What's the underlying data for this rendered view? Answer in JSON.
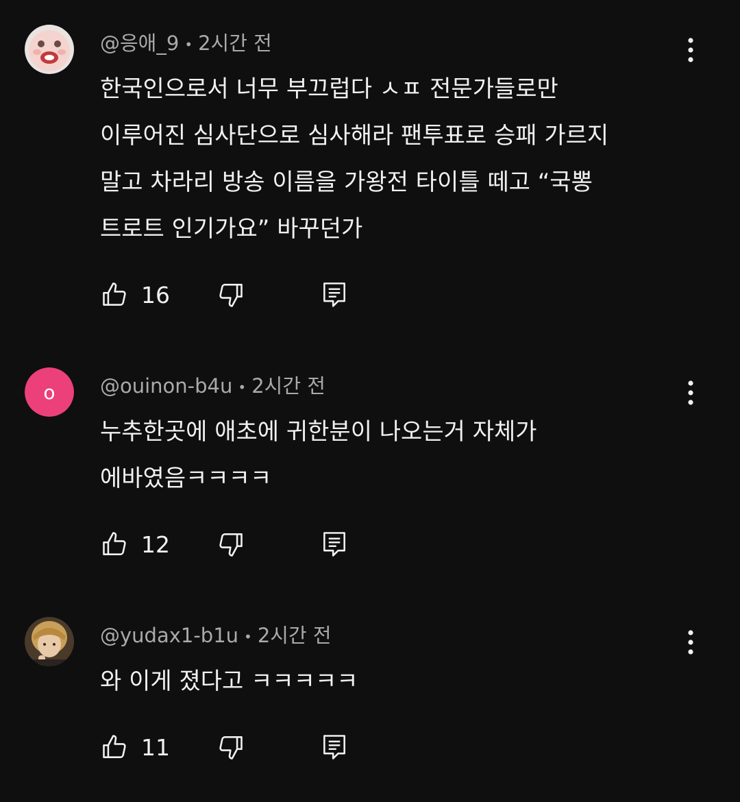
{
  "comments": [
    {
      "author": "@응애_9",
      "time": "2시간 전",
      "avatar": {
        "type": "image",
        "name": "baby-face-avatar"
      },
      "lines": [
        "한국인으로서 너무 부끄럽다 ㅅㅍ 전문가들로만",
        "이루어진 심사단으로 심사해라 팬투표로 승패 가르지",
        "말고 차라리 방송 이름을 가왕전 타이틀 떼고 “국뽕",
        "트로트 인기가요” 바꾸던가"
      ],
      "likes": "16"
    },
    {
      "author": "@ouinon-b4u",
      "time": "2시간 전",
      "avatar": {
        "type": "letter",
        "letter": "o",
        "color": "#ec407a"
      },
      "lines": [
        "누추한곳에 애초에 귀한분이 나오는거 자체가",
        "에바였음ㅋㅋㅋㅋ"
      ],
      "likes": "12"
    },
    {
      "author": "@yudax1-b1u",
      "time": "2시간 전",
      "avatar": {
        "type": "image",
        "name": "person-photo-avatar"
      },
      "lines": [
        "와 이게 졌다고 ㅋㅋㅋㅋㅋ"
      ],
      "likes": "11"
    }
  ],
  "icons": {
    "like": "thumb-up-icon",
    "dislike": "thumb-down-icon",
    "reply": "reply-icon",
    "more": "more-vertical-icon"
  },
  "colors": {
    "background": "#0f0f0f",
    "text": "#f1f1f1",
    "meta": "#aaaaaa",
    "letter_avatar": "#ec407a"
  }
}
